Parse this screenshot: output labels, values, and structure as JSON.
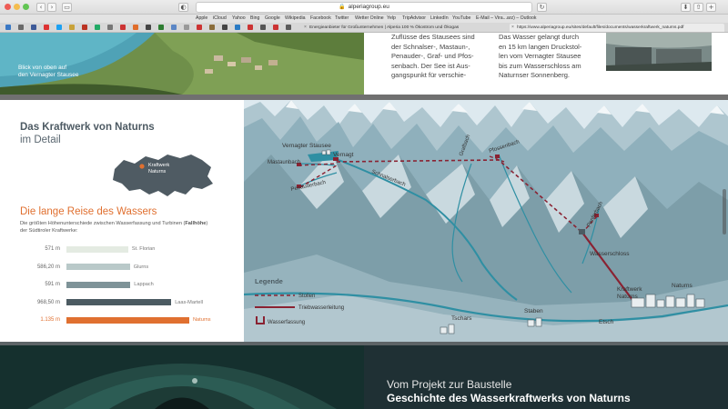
{
  "browser": {
    "url": "alperiagroup.eu",
    "bookmarks": [
      "Apple",
      "iCloud",
      "Yahoo",
      "Bing",
      "Google",
      "Wikipedia",
      "Facebook",
      "Twitter",
      "Wetter Online",
      "Yelp",
      "TripAdvisor",
      "LinkedIn",
      "YouTube",
      "E-Mail – Vira...arz) – Outlook"
    ],
    "tabs": [
      {
        "label": "Energieanbieter für Großunternehmen | Alperia 100 % Ökostrom und Ökogas",
        "active": false
      },
      {
        "label": "https://www.alperiagroup.eu/sites/default/files/documents/wasserkraftwerk_naturns.pdf",
        "active": true
      }
    ]
  },
  "top": {
    "caption_line1": "Blick von oben auf",
    "caption_line2": "den Vernagter Stausee",
    "col1": [
      "Zuflüsse des Stausees sind",
      "der Schnalser-, Mastaun-,",
      "Penauder-, Graf- und Pfos-",
      "senbach. Der See ist Aus-",
      "gangspunkt für verschie-"
    ],
    "col2": [
      "Das Wasser gelangt durch",
      "en 15 km langen Druckstol-",
      "len vom Vernagter Stausee",
      "bis zum Wasserschloss am",
      "Naturnser Sonnenberg."
    ]
  },
  "detail": {
    "title": "Das Kraftwerk von Naturns",
    "subtitle": "im Detail",
    "map_label_line1": "Kraftwerk",
    "map_label_line2": "Naturns",
    "section_title": "Die lange Reise des Wassers",
    "desc_line1": "Die größten Höhenunterschiede zwischen Wasserfassung und Turbinen (",
    "desc_bold": "Fallhöhe",
    "desc_line1_end": ")",
    "desc_line2": "der Südtiroler Kraftwerke:"
  },
  "chart_data": {
    "type": "bar",
    "categories": [
      "St. Florian",
      "Glurns",
      "Lappach",
      "Laas-Martell",
      "Naturns"
    ],
    "value_labels": [
      "571 m",
      "586,20 m",
      "591 m",
      "968,50 m",
      "1.135 m"
    ],
    "values": [
      571,
      586.2,
      591,
      968.5,
      1135
    ],
    "colors": [
      "#e4ebe2",
      "#b9c9c9",
      "#7e9398",
      "#4c5b62",
      "#e07030"
    ]
  },
  "scheme": {
    "labels": {
      "vernagter": "Vernagter Stausee",
      "vernagt": "Vernagt",
      "mastaunbach": "Mastaunbach",
      "penauderbach": "Penauderbach",
      "schnalserbach": "Schnalserbach",
      "grafbach": "Grafbach",
      "pfossenbach": "Pfossenbach",
      "penferbach": "Penferbach",
      "wasserschloss": "Wasserschloss",
      "kraftwerk1": "Kraftwerk",
      "kraftwerk2": "Naturns",
      "naturns": "Naturns",
      "tschars": "Tschars",
      "staben": "Staben",
      "etsch": "Etsch"
    },
    "legend": {
      "title": "Legende",
      "stollen": "Stollen",
      "trieb": "Triebwasserleitung",
      "fassung": "Wasserfassung"
    }
  },
  "bottom": {
    "line1": "Vom Projekt zur Baustelle",
    "line2": "Geschichte des Wasserkraftwerks von Naturns"
  },
  "colors": {
    "accent": "#e07030",
    "dark_red": "#8a2232",
    "river": "#2f8fa3"
  }
}
